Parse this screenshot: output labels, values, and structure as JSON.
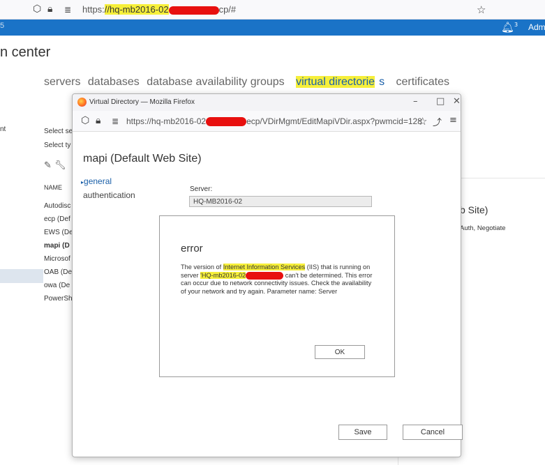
{
  "outer_browser": {
    "url_prefix": "https:",
    "url_highlight": "//hq-mb2016-02",
    "url_suffix": "cp/#"
  },
  "topbar": {
    "left_num": "5",
    "notification_count": "3",
    "admin_label": "Adm"
  },
  "ecp": {
    "title": "n center",
    "tabs": [
      "servers",
      "databases",
      "database availability groups"
    ],
    "active_tab_highlight": "virtual directorie",
    "active_tab_rest": "s",
    "tab_last": "certificates",
    "left_item": "nt",
    "select_server": "Select se",
    "select_type": "Select ty",
    "name_header": "NAME",
    "rows": [
      "Autodisc",
      "ecp (Def",
      "EWS (De",
      "mapi (D",
      "Microsof",
      "OAB (De",
      "owa (De",
      "PowerSh"
    ],
    "right_title": "b Site)",
    "right_auth": "Auth, Negotiate"
  },
  "popup": {
    "window_title": "Virtual Directory — Mozilla Firefox",
    "url_prefix": "https://hq-mb2016-02",
    "url_suffix": "ecp/VDirMgmt/EditMapiVDir.aspx?pwmcid=128",
    "heading": "mapi (Default Web Site)",
    "nav_general": "general",
    "nav_authentication": "authentication",
    "server_label": "Server:",
    "server_value": "HQ-MB2016-02",
    "save_label": "Save",
    "cancel_label": "Cancel"
  },
  "error_dialog": {
    "title": "error",
    "msg_part1": "The version of ",
    "msg_hl1": "Internet Information Services",
    "msg_part2": " (IIS) that is running on server ",
    "msg_hl2": "'HQ-mb2016-02",
    "msg_part3": " can't be determined. This error can occur due to network connectivity issues. Check the availability of your network and try again. Parameter name: Server",
    "ok_label": "OK"
  }
}
